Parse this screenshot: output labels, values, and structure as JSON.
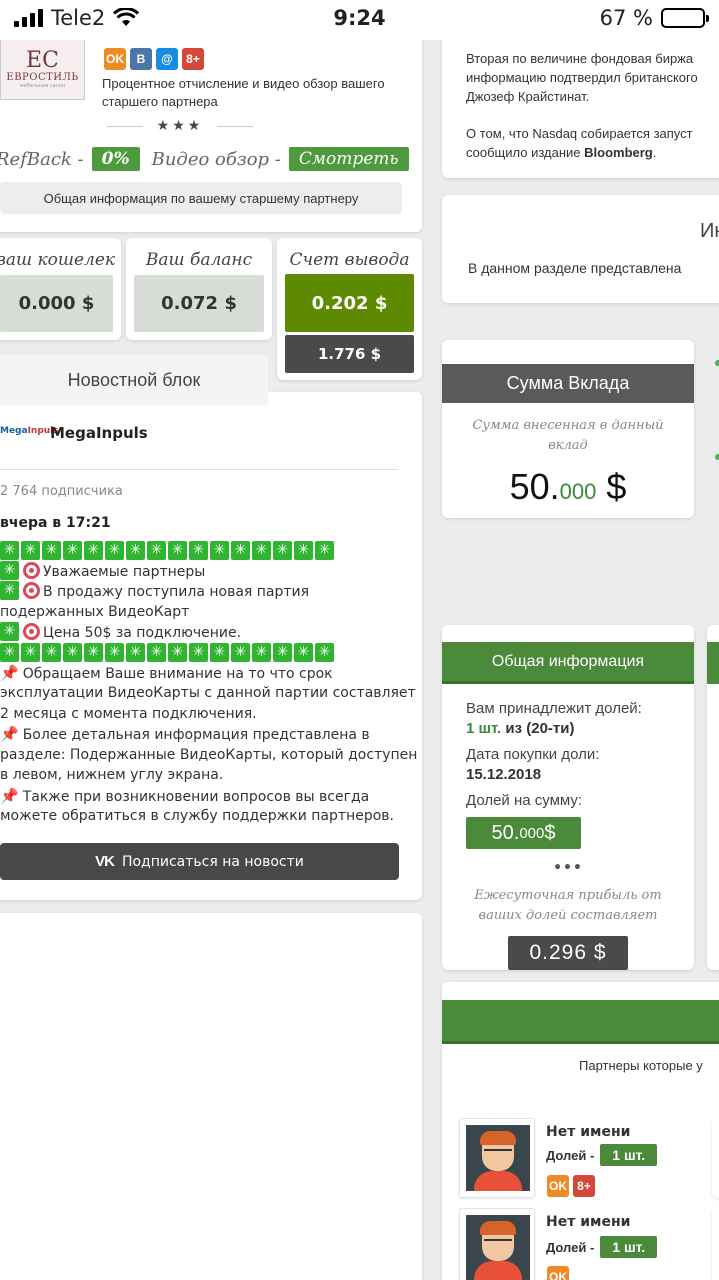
{
  "status": {
    "carrier": "Tele2",
    "time": "9:24",
    "battery": "67 %"
  },
  "partner": {
    "logo_mono": "ЕС",
    "logo_brand": "ЕВРОСТИЛЬ",
    "logo_sub": "мебельная салон",
    "social": [
      "OK",
      "B",
      "@",
      "8+"
    ],
    "description": "Процентное отчисление и видео обзор вашего старшего партнера",
    "stars": "★★★",
    "refback_label": "RefBack -",
    "refback_value": "0%",
    "video_label": "Видео обзор -",
    "video_button": "Смотреть",
    "general_info": "Общая информация по вашему старшему партнеру"
  },
  "wallets": [
    {
      "title": "ваш кошелек",
      "value": "0.000 $"
    },
    {
      "title": "Ваш баланс",
      "value": "0.072 $"
    },
    {
      "title": "Счет вывода",
      "value": "0.202 $",
      "extra": "1.776 $"
    }
  ],
  "news": {
    "tab": "Новостной блок",
    "logo_a": "Mega",
    "logo_b": "Inpuls",
    "name": "MegaInpuls",
    "subscribers": "2 764 подписчика",
    "when": "вчера в 17:21",
    "lines": [
      "Уважаемые партнеры",
      "В продажу поступила новая партия",
      "подержанных ВидеоКарт",
      "Цена 50$ за подключение.",
      "Обращаем Ваше внимание на то что срок",
      "эксплуатации ВидеоКарты с данной партии составляет",
      "2 месяца с момента подключения.",
      "Более детальная информация представлена в",
      "разделе: Подержанные ВидеоКарты, который доступен",
      "в левом, нижнем углу экрана.",
      "Также при возникновении вопросов вы всегда",
      "можете обратиться в службу поддержки партнеров."
    ],
    "vk_icon": "VK",
    "subscribe": "Подписаться на новости"
  },
  "right_news": {
    "l1": "Вторая по величине фондовая биржа",
    "l2": "информацию подтвердил британского",
    "l3": "Джозеф Крайстинат.",
    "l4": "О том, что Nasdaq собирается запуст",
    "l5a": "сообщило издание ",
    "l5b": "Bloomberg",
    "l5c": "."
  },
  "info_block": {
    "title": "Ин",
    "text": "В данном разделе представлена"
  },
  "deposit": {
    "title": "Сумма Вклада",
    "desc": "Сумма внесенная в данный вклад",
    "int": "50.",
    "frac": "000",
    "cur": " $"
  },
  "general": {
    "title": "Общая информация",
    "shares_label": "Вам принадлежит долей:",
    "shares_green": "1 шт.",
    "shares_rest": " из (20-ти)",
    "date_label": "Дата покупки доли:",
    "date_value": "15.12.2018",
    "sum_label": "Долей на сумму:",
    "sum_int": "50.",
    "sum_frac": "000",
    "sum_cur": " $",
    "dots": "•••",
    "profit_text": "Ежесуточная прибыль от ваших долей составляет",
    "daily": "0.296 $"
  },
  "referrals": {
    "text": "Партнеры которые у",
    "items": [
      {
        "name": "Нет имени",
        "shares_label": "Долей -",
        "shares": "1 шт."
      },
      {
        "name": "Нет имени",
        "shares_label": "Долей -",
        "shares": "1 шт."
      }
    ]
  },
  "colors": {
    "green": "#4a8a3a",
    "dark": "#4a4a4a",
    "olive": "#5d8a00"
  }
}
